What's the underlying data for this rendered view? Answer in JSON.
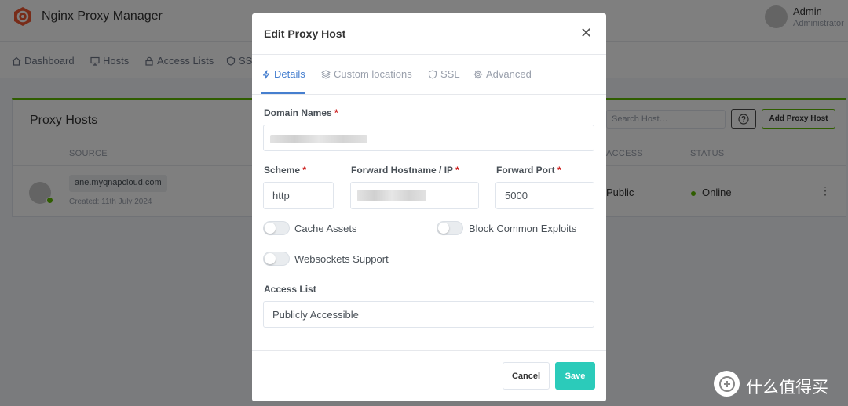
{
  "app": {
    "title": "Nginx Proxy Manager"
  },
  "user": {
    "name": "Admin",
    "role": "Administrator"
  },
  "nav": [
    {
      "label": "Dashboard",
      "icon": "home-icon"
    },
    {
      "label": "Hosts",
      "icon": "monitor-icon"
    },
    {
      "label": "Access Lists",
      "icon": "lock-icon"
    },
    {
      "label": "SSL",
      "icon": "shield-icon"
    }
  ],
  "card": {
    "title": "Proxy Hosts",
    "search_placeholder": "Search Host…",
    "add_button": "Add Proxy Host",
    "columns": {
      "source": "SOURCE",
      "access": "ACCESS",
      "status": "STATUS"
    },
    "row": {
      "domain": "ane.myqnapcloud.com",
      "created": "Created: 11th July 2024",
      "access": "Public",
      "status": "Online"
    }
  },
  "modal": {
    "title": "Edit Proxy Host",
    "tabs": [
      {
        "label": "Details",
        "icon": "lightning-icon",
        "active": true
      },
      {
        "label": "Custom locations",
        "icon": "layers-icon",
        "active": false
      },
      {
        "label": "SSL",
        "icon": "shield-icon",
        "active": false
      },
      {
        "label": "Advanced",
        "icon": "gear-icon",
        "active": false
      }
    ],
    "domain_names_label": "Domain Names",
    "scheme_label": "Scheme",
    "scheme_value": "http",
    "forward_host_label": "Forward Hostname / IP",
    "forward_port_label": "Forward Port",
    "forward_port_value": "5000",
    "required_mark": "*",
    "cache_assets_label": "Cache Assets",
    "cache_assets_on": false,
    "block_exploits_label": "Block Common Exploits",
    "block_exploits_on": false,
    "websockets_label": "Websockets Support",
    "websockets_on": false,
    "access_list_label": "Access List",
    "access_list_value": "Publicly Accessible",
    "cancel_label": "Cancel",
    "save_label": "Save"
  },
  "watermark": {
    "text": "什么值得买"
  },
  "colors": {
    "accent": "#467fcf",
    "save": "#2bcbba",
    "success": "#5eba00",
    "required": "#cd201f"
  }
}
